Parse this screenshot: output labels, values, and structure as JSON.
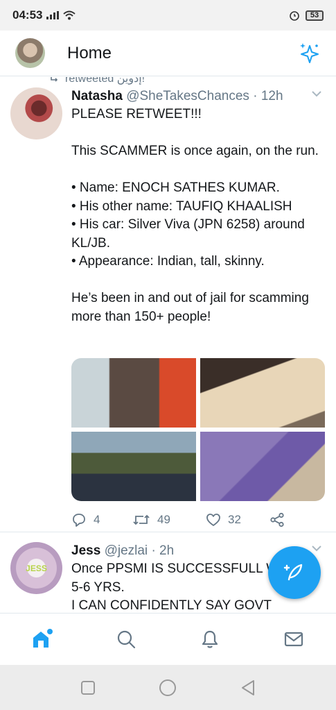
{
  "status_bar": {
    "time": "04:53",
    "battery": "53"
  },
  "header": {
    "title": "Home"
  },
  "feed": {
    "retweet_label": "retweeted إدوين!",
    "tweet1": {
      "name": "Natasha",
      "handle": "@SheTakesChances",
      "separator": "·",
      "time": "12h",
      "text": "PLEASE RETWEET!!!\n\nThis SCAMMER is once again, on the run.\n\n• Name: ENOCH SATHES KUMAR.\n• His other name: TAUFIQ KHAALISH\n• His car: Silver Viva (JPN 6258) around KL/JB.\n• Appearance: Indian, tall, skinny.\n\nHe’s been in and out of jail for scamming more than 150+ people!",
      "reply_count": "4",
      "retweet_count": "49",
      "like_count": "32"
    },
    "tweet2": {
      "name": "Jess",
      "handle": "@jezlai",
      "separator": "·",
      "time": "2h",
      "avatar_text": "JESS",
      "text": "Once PPSMI IS SUCCESSFULL W\n5-6 YRS.\nI CAN CONFIDENTLY SAY GOVT"
    }
  },
  "colors": {
    "accent": "#1da1f2",
    "secondary_text": "#657786",
    "divider": "#e1e8ed"
  },
  "icons": {
    "header": "sparkle-icon",
    "tweet_caret": "chevron-down-icon",
    "actions": [
      "reply-icon",
      "retweet-icon",
      "like-icon",
      "share-icon"
    ],
    "fab": "compose-feather-icon",
    "nav": [
      "home-icon",
      "search-icon",
      "notifications-bell-icon",
      "messages-envelope-icon"
    ],
    "system": [
      "recents-square-icon",
      "home-circle-icon",
      "back-triangle-icon"
    ]
  }
}
